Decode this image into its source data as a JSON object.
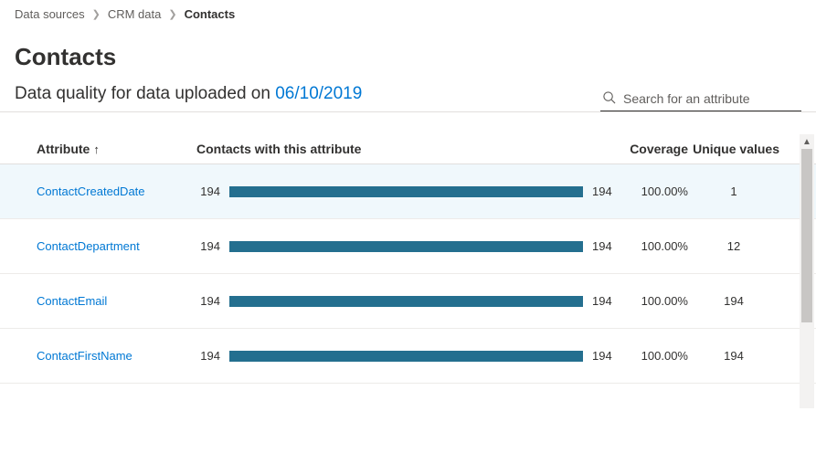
{
  "breadcrumb": {
    "l0": "Data sources",
    "l1": "CRM data",
    "l2": "Contacts"
  },
  "page_title": "Contacts",
  "subheader": {
    "prefix": "Data quality for data uploaded on ",
    "date": "06/10/2019"
  },
  "search": {
    "placeholder": "Search for an attribute"
  },
  "columns": {
    "attribute": "Attribute",
    "contacts": "Contacts with this attribute",
    "coverage": "Coverage",
    "unique": "Unique values"
  },
  "rows": [
    {
      "name": "ContactCreatedDate",
      "count_left": "194",
      "count_right": "194",
      "fill": 100,
      "coverage": "100.00%",
      "unique": "1",
      "selected": true
    },
    {
      "name": "ContactDepartment",
      "count_left": "194",
      "count_right": "194",
      "fill": 100,
      "coverage": "100.00%",
      "unique": "12",
      "selected": false
    },
    {
      "name": "ContactEmail",
      "count_left": "194",
      "count_right": "194",
      "fill": 100,
      "coverage": "100.00%",
      "unique": "194",
      "selected": false
    },
    {
      "name": "ContactFirstName",
      "count_left": "194",
      "count_right": "194",
      "fill": 100,
      "coverage": "100.00%",
      "unique": "194",
      "selected": false
    }
  ]
}
